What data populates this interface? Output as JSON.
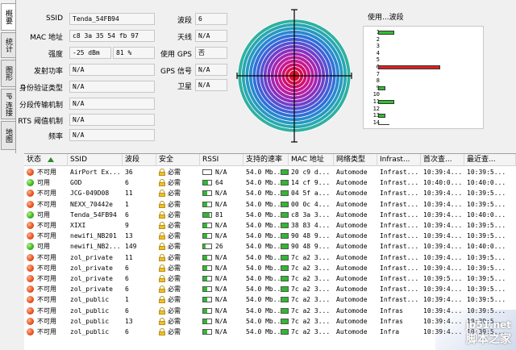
{
  "vtabs": [
    "概要",
    "统计",
    "图形",
    "IP 连接",
    "地图"
  ],
  "info_left": [
    {
      "label": "SSID",
      "value": "Tenda_54FB94"
    },
    {
      "label": "MAC 地址",
      "value": "c8 3a 35 54 fb 97"
    },
    {
      "label": "强度",
      "value": "-25 dBm",
      "value2": "81 %"
    },
    {
      "label": "发射功率",
      "value": "N/A"
    },
    {
      "label": "身份验证类型",
      "value": "N/A"
    },
    {
      "label": "分段传输机制",
      "value": "N/A"
    },
    {
      "label": "RTS 阈值机制",
      "value": "N/A"
    },
    {
      "label": "频率",
      "value": "N/A"
    }
  ],
  "info_right": [
    {
      "label": "波段",
      "value": "6"
    },
    {
      "label": "天线",
      "value": "N/A"
    },
    {
      "label": "使用 GPS",
      "value": "否"
    },
    {
      "label": "GPS 信号",
      "value": "N/A"
    },
    {
      "label": "卫星",
      "value": "N/A"
    }
  ],
  "usage": {
    "title": "使用...波段",
    "channels": [
      {
        "num": "1",
        "level": 0.13,
        "color": "#30c030"
      },
      {
        "num": "2",
        "level": 0,
        "color": "#30c030"
      },
      {
        "num": "3",
        "level": 0,
        "color": "#30c030"
      },
      {
        "num": "4",
        "level": 0,
        "color": "#30c030"
      },
      {
        "num": "5",
        "level": 0,
        "color": "#30c030"
      },
      {
        "num": "6",
        "level": 0.5,
        "color": "#e02020"
      },
      {
        "num": "7",
        "level": 0,
        "color": "#30c030"
      },
      {
        "num": "8",
        "level": 0,
        "color": "#30c030"
      },
      {
        "num": "9",
        "level": 0.06,
        "color": "#30c030"
      },
      {
        "num": "10",
        "level": 0,
        "color": "#30c030"
      },
      {
        "num": "11",
        "level": 0.13,
        "color": "#30c030"
      },
      {
        "num": "12",
        "level": 0,
        "color": "#30c030"
      },
      {
        "num": "13",
        "level": 0.06,
        "color": "#30c030"
      },
      {
        "num": "14",
        "level": 0,
        "color": "#30c030"
      }
    ]
  },
  "table": {
    "headers": [
      "状态",
      "SSID",
      "波段",
      "安全",
      "RSSI",
      "支持的速率",
      "MAC 地址",
      "网络类型",
      "Infrast...",
      "首次查...",
      "最近查..."
    ],
    "rows": [
      {
        "ok": false,
        "status": "不可用",
        "ssid": "AirPort Ex...",
        "ch": "36",
        "sec": "必需",
        "rssi": "N/A",
        "rssi_level": 0,
        "rate": "54.0 Mb...",
        "mac": "20 c9 d...",
        "net": "Automode",
        "infra": "Infrast...",
        "first": "10:39:4...",
        "last": "10:39:5..."
      },
      {
        "ok": true,
        "status": "可用",
        "ssid": "GOD",
        "ch": "6",
        "sec": "必需",
        "rssi": "64",
        "rssi_level": 0.64,
        "rate": "54.0 Mb...",
        "mac": "14 cf 9...",
        "net": "Automode",
        "infra": "Infrast...",
        "first": "10:40:0...",
        "last": "10:40:0..."
      },
      {
        "ok": false,
        "status": "不可用",
        "ssid": "JCG-049D08",
        "ch": "11",
        "sec": "必需",
        "rssi": "N/A",
        "rssi_level": 0.5,
        "rate": "54.0 Mb...",
        "mac": "04 5f a...",
        "net": "Automode",
        "infra": "Infrast...",
        "first": "10:39:4...",
        "last": "10:39:5..."
      },
      {
        "ok": false,
        "status": "不可用",
        "ssid": "NEXX_70442e",
        "ch": "1",
        "sec": "必需",
        "rssi": "N/A",
        "rssi_level": 0.5,
        "rate": "54.0 Mb...",
        "mac": "00 0c 4...",
        "net": "Automode",
        "infra": "Infrast...",
        "first": "10:39:4...",
        "last": "10:39:5..."
      },
      {
        "ok": true,
        "status": "可用",
        "ssid": "Tenda_54FB94",
        "ch": "6",
        "sec": "必需",
        "rssi": "81",
        "rssi_level": 0.81,
        "rate": "54.0 Mb...",
        "mac": "c8 3a 3...",
        "net": "Automode",
        "infra": "Infrast...",
        "first": "10:39:4...",
        "last": "10:40:0..."
      },
      {
        "ok": false,
        "status": "不可用",
        "ssid": "XIXI",
        "ch": "9",
        "sec": "必需",
        "rssi": "N/A",
        "rssi_level": 0.5,
        "rate": "54.0 Mb...",
        "mac": "38 83 4...",
        "net": "Automode",
        "infra": "Infrast...",
        "first": "10:39:4...",
        "last": "10:39:5..."
      },
      {
        "ok": false,
        "status": "不可用",
        "ssid": "newifi_NB201",
        "ch": "13",
        "sec": "必需",
        "rssi": "N/A",
        "rssi_level": 0.5,
        "rate": "54.0 Mb...",
        "mac": "90 48 9...",
        "net": "Automode",
        "infra": "Infrast...",
        "first": "10:39:4...",
        "last": "10:39:5..."
      },
      {
        "ok": true,
        "status": "可用",
        "ssid": "newifi_NB2...",
        "ch": "149",
        "sec": "必需",
        "rssi": "26",
        "rssi_level": 0.26,
        "rate": "54.0 Mb...",
        "mac": "90 48 9...",
        "net": "Automode",
        "infra": "Infrast...",
        "first": "10:39:4...",
        "last": "10:40:0..."
      },
      {
        "ok": false,
        "status": "不可用",
        "ssid": "zol_private",
        "ch": "11",
        "sec": "必需",
        "rssi": "N/A",
        "rssi_level": 0.5,
        "rate": "54.0 Mb...",
        "mac": "7c a2 3...",
        "net": "Automode",
        "infra": "Infrast...",
        "first": "10:39:4...",
        "last": "10:39:5..."
      },
      {
        "ok": false,
        "status": "不可用",
        "ssid": "zol_private",
        "ch": "6",
        "sec": "必需",
        "rssi": "N/A",
        "rssi_level": 0.5,
        "rate": "54.0 Mb...",
        "mac": "7c a2 3...",
        "net": "Automode",
        "infra": "Infrast...",
        "first": "10:39:4...",
        "last": "10:39:5..."
      },
      {
        "ok": false,
        "status": "不可用",
        "ssid": "zol_private",
        "ch": "6",
        "sec": "必需",
        "rssi": "N/A",
        "rssi_level": 0.5,
        "rate": "54.0 Mb...",
        "mac": "7c a2 3...",
        "net": "Automode",
        "infra": "Infrast...",
        "first": "10:39:5...",
        "last": "10:39:5..."
      },
      {
        "ok": false,
        "status": "不可用",
        "ssid": "zol_private",
        "ch": "6",
        "sec": "必需",
        "rssi": "N/A",
        "rssi_level": 0.5,
        "rate": "54.0 Mb...",
        "mac": "7c a2 3...",
        "net": "Automode",
        "infra": "Infrast...",
        "first": "10:39:4...",
        "last": "10:39:5..."
      },
      {
        "ok": false,
        "status": "不可用",
        "ssid": "zol_public",
        "ch": "1",
        "sec": "必需",
        "rssi": "N/A",
        "rssi_level": 0.5,
        "rate": "54.0 Mb...",
        "mac": "7c a2 3...",
        "net": "Automode",
        "infra": "Infrast...",
        "first": "10:39:4...",
        "last": "10:39:5..."
      },
      {
        "ok": false,
        "status": "不可用",
        "ssid": "zol_public",
        "ch": "6",
        "sec": "必需",
        "rssi": "N/A",
        "rssi_level": 0.5,
        "rate": "54.0 Mb...",
        "mac": "7c a2 3...",
        "net": "Automode",
        "infra": "Infras",
        "first": "10:39:4...",
        "last": "10:39:5..."
      },
      {
        "ok": false,
        "status": "不可用",
        "ssid": "zol_public",
        "ch": "13",
        "sec": "必需",
        "rssi": "N/A",
        "rssi_level": 0.5,
        "rate": "54.0 Mb...",
        "mac": "7c a2 3...",
        "net": "Automode",
        "infra": "Infras",
        "first": "10:39:4...",
        "last": "10:39:5..."
      },
      {
        "ok": false,
        "status": "不可用",
        "ssid": "zol_public",
        "ch": "6",
        "sec": "必需",
        "rssi": "N/A",
        "rssi_level": 0.5,
        "rate": "54.0 Mb...",
        "mac": "7c a2 3...",
        "net": "Automode",
        "infra": "Infra",
        "first": "10:39:4...",
        "last": "10:39:5..."
      }
    ]
  },
  "watermark": {
    "line1": "jb51.net",
    "line2": "脚本之家"
  }
}
